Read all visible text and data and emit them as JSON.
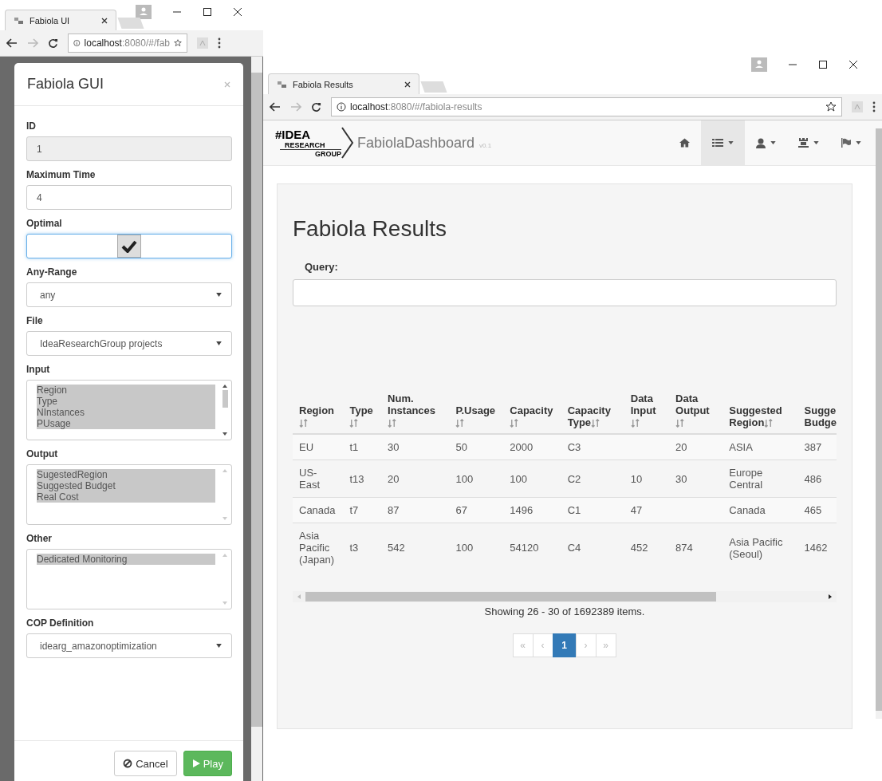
{
  "left_window": {
    "tab_title": "Fabiola UI",
    "url_host": "localhost",
    "url_rest": ":8080/#/fab",
    "modal": {
      "title": "Fabiola GUI",
      "fields": [
        {
          "kind": "text",
          "label": "ID",
          "value": "1",
          "disabled": true
        },
        {
          "kind": "text",
          "label": "Maximum Time",
          "value": "4",
          "disabled": false
        },
        {
          "kind": "toggle",
          "label": "Optimal",
          "checked": true
        },
        {
          "kind": "select",
          "label": "Any-Range",
          "value": "any"
        },
        {
          "kind": "select",
          "label": "File",
          "value": "IdeaResearchGroup projects"
        },
        {
          "kind": "multiselect",
          "label": "Input",
          "scrollable": true,
          "options": [
            {
              "text": "Region",
              "selected": true
            },
            {
              "text": "Type",
              "selected": true
            },
            {
              "text": "NInstances",
              "selected": true
            },
            {
              "text": "PUsage",
              "selected": true
            }
          ]
        },
        {
          "kind": "multiselect",
          "label": "Output",
          "scrollable": false,
          "options": [
            {
              "text": "SugestedRegion",
              "selected": true
            },
            {
              "text": "Suggested Budget",
              "selected": true
            },
            {
              "text": "Real Cost",
              "selected": true
            }
          ]
        },
        {
          "kind": "multiselect",
          "label": "Other",
          "scrollable": false,
          "options": [
            {
              "text": "Dedicated Monitoring",
              "selected": true
            }
          ]
        },
        {
          "kind": "select",
          "label": "COP Definition",
          "value": "idearg_amazonoptimization"
        }
      ],
      "buttons": [
        {
          "kind": "cancel",
          "label": "Cancel"
        },
        {
          "kind": "play",
          "label": "Play"
        }
      ]
    }
  },
  "right_window": {
    "tab_title": "Fabiola Results",
    "url_host": "localhost",
    "url_rest": ":8080/#/fabiola-results",
    "logo": {
      "line1": "#IDEA",
      "line2": "RESEARCH",
      "line3": "GROUP"
    },
    "brand": "FabiolaDashboard",
    "version": "v0.1",
    "nav": [
      {
        "kind": "home",
        "caret": false,
        "selected": false
      },
      {
        "kind": "list",
        "caret": true,
        "selected": true
      },
      {
        "kind": "user",
        "caret": true,
        "selected": false
      },
      {
        "kind": "castle",
        "caret": true,
        "selected": false
      },
      {
        "kind": "flag",
        "caret": true,
        "selected": false
      }
    ],
    "page_title": "Fabiola Results",
    "query_label": "Query:",
    "table": {
      "columns": [
        "Region",
        "Type",
        "Num. Instances",
        "P.Usage",
        "Capacity",
        "Capacity Type",
        "Data Input",
        "Data Output",
        "Suggested Region",
        "Sugge Budge"
      ],
      "rows": [
        [
          "EU",
          "t1",
          "30",
          "50",
          "2000",
          "C3",
          "",
          "20",
          "ASIA",
          "387"
        ],
        [
          "US-East",
          "t13",
          "20",
          "100",
          "100",
          "C2",
          "10",
          "30",
          "Europe Central",
          "486"
        ],
        [
          "Canada",
          "t7",
          "87",
          "67",
          "1496",
          "C1",
          "47",
          "",
          "Canada",
          "465"
        ],
        [
          "Asia Pacific (Japan)",
          "t3",
          "542",
          "100",
          "54120",
          "C4",
          "452",
          "874",
          "Asia Pacific (Seoul)",
          "1462"
        ]
      ]
    },
    "status": "Showing 26 - 30 of 1692389 items.",
    "pagination": [
      {
        "label": "«",
        "selected": false,
        "disabled": true
      },
      {
        "label": "‹",
        "selected": false,
        "disabled": true
      },
      {
        "label": "1",
        "selected": true,
        "disabled": false
      },
      {
        "label": "›",
        "selected": false,
        "disabled": true
      },
      {
        "label": "»",
        "selected": false,
        "disabled": true
      }
    ]
  }
}
